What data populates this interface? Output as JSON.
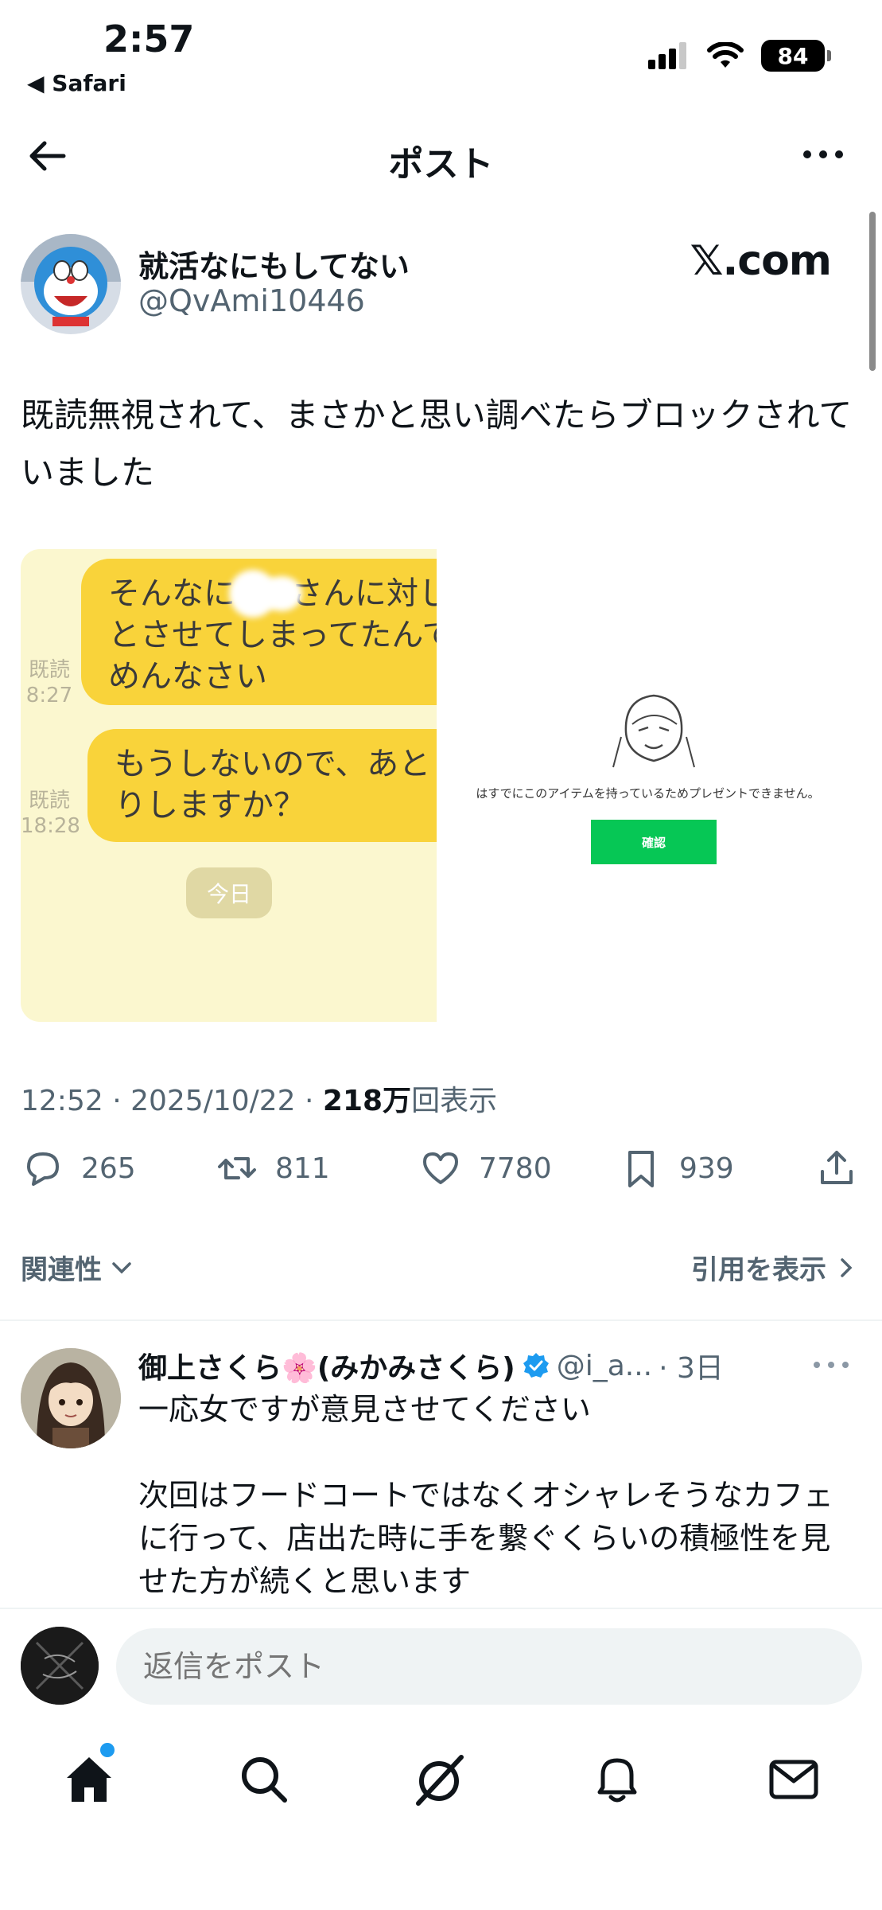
{
  "status_bar": {
    "time": "2:57",
    "back_app": "◀ Safari",
    "battery": "84"
  },
  "header": {
    "title": "ポスト"
  },
  "post": {
    "author_name": "就活なにもしてない",
    "author_handle": "@QvAmi10446",
    "source_label": "𝕏.com",
    "text": "既読無視されて、まさかと思い調べたらブロックされていました",
    "media": {
      "left": {
        "bubble1_lines": [
          "そんなに",
          "とさせてしまってたんて",
          "めんなさい"
        ],
        "bubble1_suffix": "さんに対し",
        "read1_label": "既読",
        "read1_time": "8:27",
        "bubble2_lines": [
          "もうしないので、あと",
          "りしますか？"
        ],
        "read2_label": "既読",
        "read2_time": "18:28",
        "today_chip": "今日"
      },
      "right": {
        "message": "はすでにこのアイテムを持っているためプレゼントできません。",
        "confirm_label": "確認"
      }
    },
    "timestamp": "12:52 · 2025/10/22 · ",
    "views_count": "218万",
    "views_label": "回表示",
    "stats": {
      "replies": "265",
      "reposts": "811",
      "likes": "7780",
      "bookmarks": "939"
    },
    "sort_label": "関連性",
    "quotes_label": "引用を表示"
  },
  "reply": {
    "name": "御上さくら🌸(みかみさくら)",
    "handle": "@i_a...",
    "age": "· 3日",
    "text": [
      "一応女ですが意見させてください",
      "",
      "次回はフードコートではなくオシャレそうなカフェに行って、店出た時に手を繋ぐくらいの積極性を見せた方が続くと思います"
    ]
  },
  "composer": {
    "placeholder": "返信をポスト"
  },
  "nav": {
    "items": [
      "home-icon",
      "search-icon",
      "grok-icon",
      "notifications-icon",
      "messages-icon"
    ],
    "accent": "#1d9bf0"
  }
}
